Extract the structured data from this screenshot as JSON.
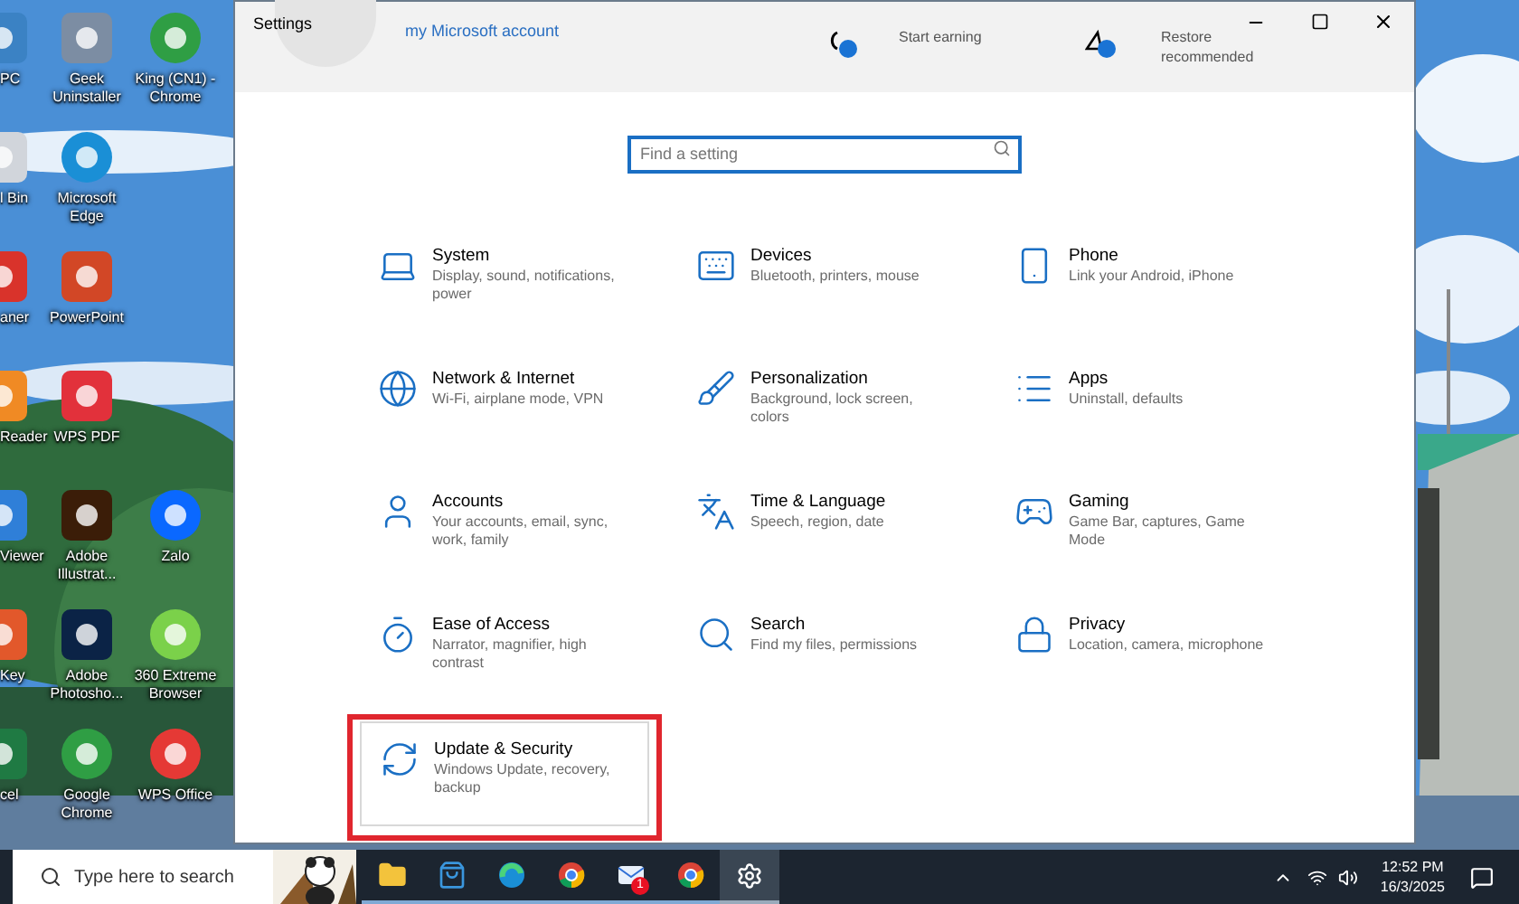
{
  "desktop_columns": [
    {
      "icons": [
        {
          "label": "PC",
          "kind": "pc"
        },
        {
          "label": "l Bin",
          "kind": "bin"
        },
        {
          "label": "aner",
          "kind": "cleaner"
        },
        {
          "label": "Reader",
          "kind": "reader"
        },
        {
          "label": "Viewer",
          "kind": "viewer"
        },
        {
          "label": "Key",
          "kind": "key"
        },
        {
          "label": "cel",
          "kind": "excel"
        }
      ]
    },
    {
      "icons": [
        {
          "label": "Geek Uninstaller",
          "kind": "uninstaller"
        },
        {
          "label": "Microsoft Edge",
          "kind": "edge"
        },
        {
          "label": "PowerPoint",
          "kind": "powerpoint"
        },
        {
          "label": "WPS PDF",
          "kind": "wpspdf"
        },
        {
          "label": "Adobe Illustrat...",
          "kind": "illustrator"
        },
        {
          "label": "Adobe Photosho...",
          "kind": "photoshop"
        },
        {
          "label": "Google Chrome",
          "kind": "chrome"
        }
      ]
    },
    {
      "icons": [
        {
          "label": "King (CN1) - Chrome",
          "kind": "chrome"
        },
        {
          "label": "Zalo",
          "kind": "zalo"
        },
        {
          "label": "360 Extreme Browser",
          "kind": "browser360"
        },
        {
          "label": "WPS Office",
          "kind": "wpsoffice"
        }
      ]
    }
  ],
  "window": {
    "title": "Settings"
  },
  "header": {
    "account_link": "my Microsoft account",
    "rewards": "Start earning",
    "backup": [
      "Restore",
      "recommended"
    ]
  },
  "search": {
    "placeholder": "Find a setting"
  },
  "settings": [
    {
      "title": "System",
      "description": "Display, sound, notifications, power",
      "highlighted": false
    },
    {
      "title": "Devices",
      "description": "Bluetooth, printers, mouse",
      "highlighted": false
    },
    {
      "title": "Phone",
      "description": "Link your Android, iPhone",
      "highlighted": false
    },
    {
      "title": "Network & Internet",
      "description": "Wi-Fi, airplane mode, VPN",
      "highlighted": false
    },
    {
      "title": "Personalization",
      "description": "Background, lock screen, colors",
      "highlighted": false
    },
    {
      "title": "Apps",
      "description": "Uninstall, defaults",
      "highlighted": false
    },
    {
      "title": "Accounts",
      "description": "Your accounts, email, sync, work, family",
      "highlighted": false
    },
    {
      "title": "Time & Language",
      "description": "Speech, region, date",
      "highlighted": false
    },
    {
      "title": "Gaming",
      "description": "Game Bar, captures, Game Mode",
      "highlighted": false
    },
    {
      "title": "Ease of Access",
      "description": "Narrator, magnifier, high contrast",
      "highlighted": false
    },
    {
      "title": "Search",
      "description": "Find my files, permissions",
      "highlighted": false
    },
    {
      "title": "Privacy",
      "description": "Location, camera, microphone",
      "highlighted": false
    },
    {
      "title": "Update & Security",
      "description": "Windows Update, recovery, backup",
      "highlighted": true
    }
  ],
  "taskbar": {
    "search_placeholder": "Type here to search",
    "apps": [
      {
        "kind": "folder",
        "selected": false
      },
      {
        "kind": "store",
        "selected": false
      },
      {
        "kind": "edge",
        "selected": false
      },
      {
        "kind": "chrome",
        "selected": false
      },
      {
        "kind": "mail",
        "selected": false,
        "badge": "1"
      },
      {
        "kind": "chrome",
        "selected": false
      },
      {
        "kind": "settings",
        "selected": true
      }
    ],
    "time": "12:52 PM",
    "date": "16/3/2025"
  }
}
